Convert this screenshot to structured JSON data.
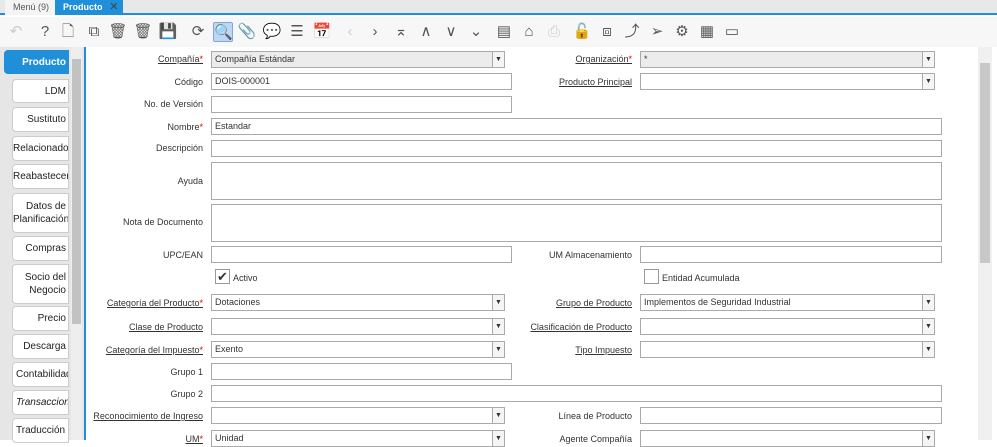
{
  "tabs": {
    "menu": "Menú (9)",
    "active": "Producto"
  },
  "toolbar": [
    "undo-icon",
    "help-icon",
    "new-icon",
    "copy-icon",
    "delete-icon",
    "delete-selection-icon",
    "save-icon",
    "refresh-icon",
    "find-icon",
    "attachment-icon",
    "chat-icon",
    "grid-toggle-icon",
    "calendar-icon",
    "previous-icon",
    "next-icon",
    "first-icon",
    "up-icon",
    "down-icon",
    "last-icon",
    "report-icon",
    "archive-icon",
    "print-icon",
    "lock-icon",
    "zoom-across-icon",
    "workflow-icon",
    "send-icon",
    "process-icon",
    "product-info-icon",
    "form-icon"
  ],
  "side_tabs": [
    "Producto",
    "LDM",
    "Sustituto",
    "Relacionado",
    "Reabastecer",
    "Datos de Planificación",
    "Compras",
    "Socio del Negocio",
    "Precio",
    "Descarga",
    "Contabilidad",
    "Transacciones",
    "Traducción"
  ],
  "form": {
    "company": {
      "label": "Compañía",
      "value": "Compañía Estándar"
    },
    "org": {
      "label": "Organización",
      "value": "*"
    },
    "code": {
      "label": "Código",
      "value": "DOIS-000001"
    },
    "main_product": {
      "label": "Producto Principal",
      "value": ""
    },
    "version": {
      "label": "No. de Versión",
      "value": ""
    },
    "name": {
      "label": "Nombre",
      "value": "Estandar"
    },
    "description": {
      "label": "Descripción",
      "value": ""
    },
    "help": {
      "label": "Ayuda",
      "value": ""
    },
    "doc_note": {
      "label": "Nota de Documento",
      "value": ""
    },
    "upc": {
      "label": "UPC/EAN",
      "value": ""
    },
    "uom_storage": {
      "label": "UM Almacenamiento",
      "value": ""
    },
    "active": {
      "label": "Activo",
      "checked": true
    },
    "accrued": {
      "label": "Entidad Acumulada",
      "checked": false
    },
    "category": {
      "label": "Categoría del Producto",
      "value": "Dotaciones"
    },
    "group": {
      "label": "Grupo de Producto",
      "value": "Implementos de Seguridad Industrial"
    },
    "class": {
      "label": "Clase de Producto",
      "value": ""
    },
    "classification": {
      "label": "Clasificación de Producto",
      "value": ""
    },
    "tax_category": {
      "label": "Categoría del Impuesto",
      "value": "Exento"
    },
    "tax_type": {
      "label": "Tipo Impuesto",
      "value": ""
    },
    "group1": {
      "label": "Grupo 1",
      "value": ""
    },
    "group2": {
      "label": "Grupo 2",
      "value": ""
    },
    "revenue": {
      "label": "Reconocimiento de Ingreso",
      "value": ""
    },
    "product_line": {
      "label": "Línea de Producto",
      "value": ""
    },
    "uom": {
      "label": "UM",
      "value": "Unidad"
    },
    "sales_rep": {
      "label": "Agente Compañía",
      "value": ""
    }
  },
  "required_mark": "*"
}
